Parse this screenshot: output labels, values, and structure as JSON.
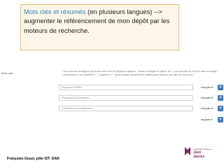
{
  "callout": {
    "part1": "Mots clés et résumés",
    "part2": " (en plusieurs langues) --> augmenter le référencement de mon dépôt par les moteurs de recherche."
  },
  "form": {
    "side_label": "Mots clés",
    "help_text": "Vous pouvez renseigner plusieurs mots clés en plusieurs langues : choisir la langue et cliquer sur + pour ajouter un mot clé dans la langue sélectionnée. Les caractères \",\" (virgule) et \";\" (point virgule) peuvent être utilisés pour séparer une liste de mots clés.",
    "keywords": [
      {
        "value": "Raymond Raffet",
        "lang": "français ▾",
        "button": "×"
      },
      {
        "value": "Révolutions européen",
        "lang": "français ▾",
        "button": "×"
      },
      {
        "value": "Commission européenne",
        "lang": "français ▾",
        "button": "×"
      }
    ],
    "add_lang": "anglais ▾",
    "add_button": "+"
  },
  "footer": {
    "author": "Françoise Gouzi, pôle IST- DAR"
  },
  "logo": {
    "line1": "Université Toulouse",
    "line2": "Jean",
    "line3": "Jaurès"
  },
  "colors": {
    "accent": "#2e83c3",
    "button": "#3f78c6",
    "callout_border": "#e3c37a"
  }
}
